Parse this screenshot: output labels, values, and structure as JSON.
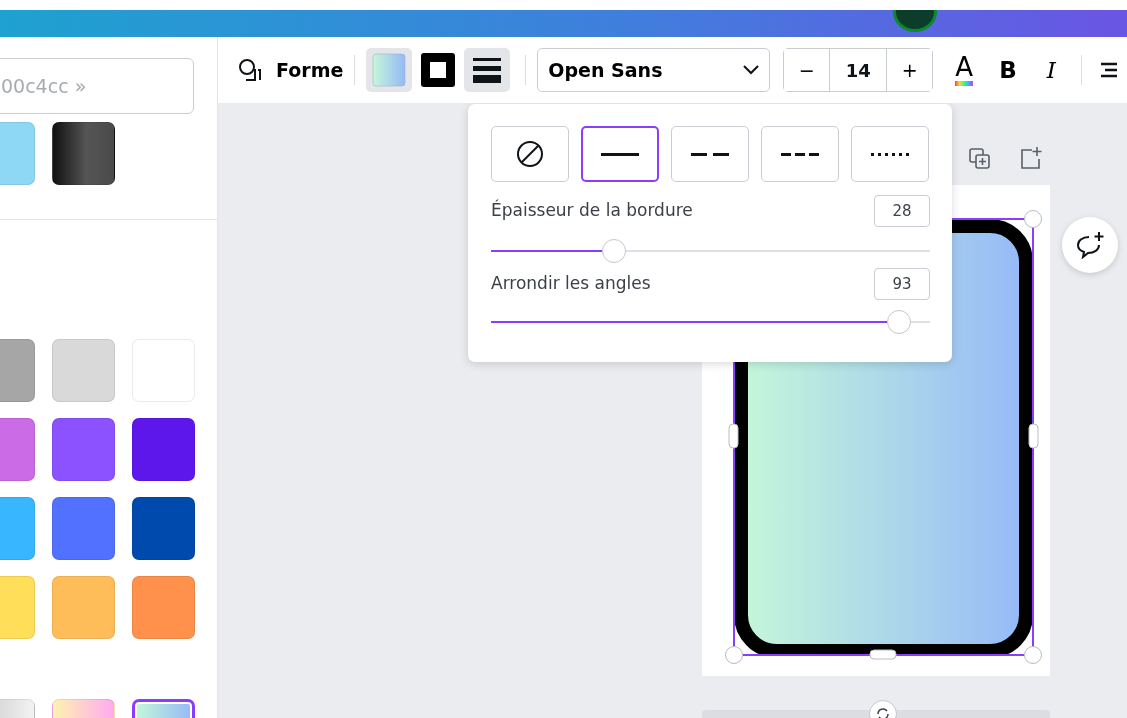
{
  "search": {
    "placeholder": "00c4cc »"
  },
  "swatches_top": [
    {
      "kind": "solid",
      "color": "#8fd8f5",
      "selected": false
    },
    {
      "kind": "gradient-dark",
      "selected": false
    }
  ],
  "swatch_grid": [
    {
      "kind": "solid",
      "color": "#a6a6a6",
      "selected": false
    },
    {
      "kind": "solid",
      "color": "#d9d9d9",
      "selected": false
    },
    {
      "kind": "solid",
      "color": "#ffffff",
      "selected": false
    },
    {
      "kind": "solid",
      "color": "#cb6ce6",
      "selected": false
    },
    {
      "kind": "solid",
      "color": "#8c52ff",
      "selected": false
    },
    {
      "kind": "solid",
      "color": "#5e17eb",
      "selected": false
    },
    {
      "kind": "solid",
      "color": "#38b6ff",
      "selected": false
    },
    {
      "kind": "solid",
      "color": "#5271ff",
      "selected": false
    },
    {
      "kind": "solid",
      "color": "#004aad",
      "selected": false
    },
    {
      "kind": "solid",
      "color": "#ffde59",
      "selected": false
    },
    {
      "kind": "solid",
      "color": "#ffbd59",
      "selected": false
    },
    {
      "kind": "solid",
      "color": "#ff914d",
      "selected": false
    }
  ],
  "swatches_bottom": [
    {
      "kind": "gradient-grey",
      "selected": false
    },
    {
      "kind": "gradient-pastel",
      "selected": false
    },
    {
      "kind": "gradient-mint",
      "selected": true
    }
  ],
  "toolbar": {
    "shape_label": "Forme",
    "tools": [
      {
        "kind": "fill",
        "selected": true
      },
      {
        "kind": "border-color",
        "selected": false
      },
      {
        "kind": "border-style",
        "selected": true
      }
    ],
    "font": "Open Sans",
    "font_size": "14",
    "decrease": "−",
    "increase": "+",
    "text_color": "A",
    "bold": "B",
    "italic": "I"
  },
  "border_styles": [
    {
      "kind": "none",
      "selected": false
    },
    {
      "kind": "solid",
      "selected": true
    },
    {
      "kind": "long-dash",
      "selected": false
    },
    {
      "kind": "short-dash",
      "selected": false
    },
    {
      "kind": "dotted",
      "selected": false
    }
  ],
  "sliders": [
    {
      "label": "Épaisseur de la bordure",
      "reading": "28",
      "level": 0.28
    },
    {
      "label": "Arrondir les angles",
      "reading": "93",
      "level": 0.93
    }
  ]
}
